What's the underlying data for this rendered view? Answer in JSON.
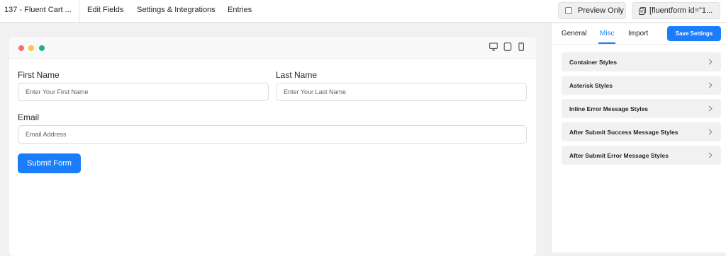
{
  "header": {
    "form_title": "137 - Fluent Cart ...",
    "nav": {
      "edit_fields": "Edit Fields",
      "settings_integrations": "Settings & Integrations",
      "entries": "Entries"
    },
    "preview_only_label": "Preview Only",
    "preview_only_checked": false,
    "shortcode_label": "[fluentform id=\"1..."
  },
  "preview": {
    "window_dots": [
      "red",
      "yellow",
      "green"
    ],
    "device_icons": [
      "desktop-icon",
      "tablet-icon",
      "mobile-icon"
    ],
    "form": {
      "first_name": {
        "label": "First Name",
        "placeholder": "Enter Your First Name",
        "value": ""
      },
      "last_name": {
        "label": "Last Name",
        "placeholder": "Enter Your Last Name",
        "value": ""
      },
      "email": {
        "label": "Email",
        "placeholder": "Email Address",
        "value": ""
      },
      "submit_label": "Submit Form"
    }
  },
  "sidebar": {
    "tabs": [
      {
        "label": "General",
        "active": false
      },
      {
        "label": "Misc",
        "active": true
      },
      {
        "label": "Import",
        "active": false
      }
    ],
    "save_label": "Save Settings",
    "sections": [
      {
        "label": "Container Styles"
      },
      {
        "label": "Asterisk Styles"
      },
      {
        "label": "Inline Error Message Styles"
      },
      {
        "label": "After Submit Success Message Styles"
      },
      {
        "label": "After Submit Error Message Styles"
      }
    ]
  },
  "colors": {
    "accent": "#1a7efb",
    "dot_red": "#ff6b6b",
    "dot_yellow": "#fcc63b",
    "dot_green": "#1bb37e"
  }
}
